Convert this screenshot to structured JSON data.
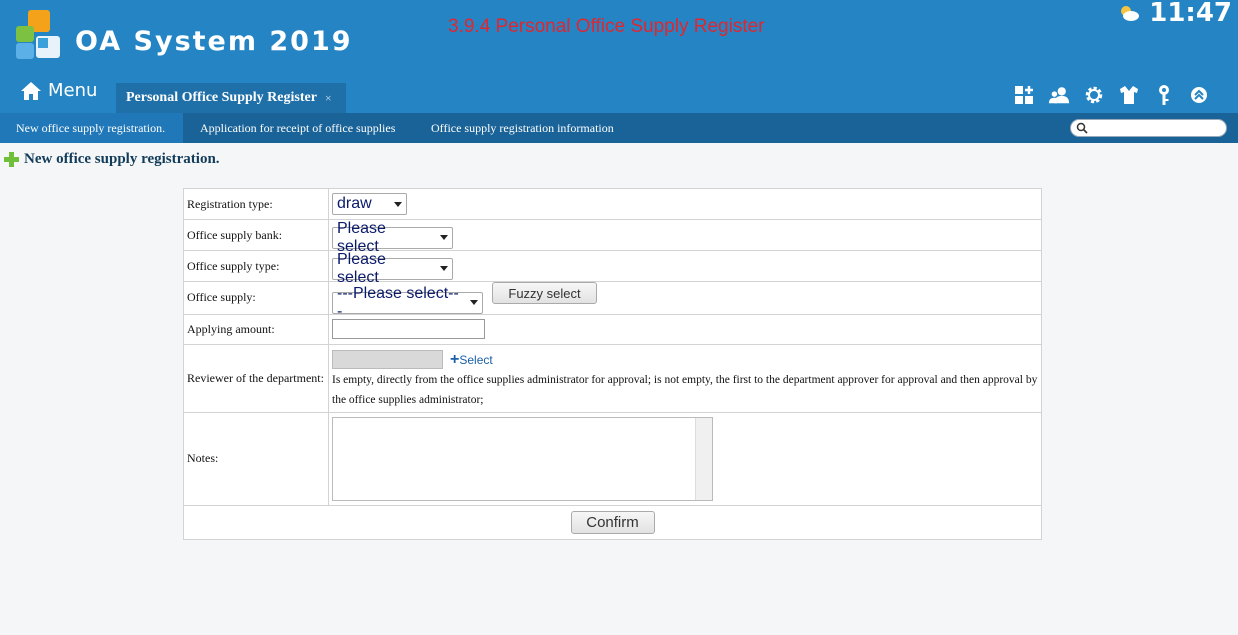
{
  "header": {
    "app_title": "OA System 2019",
    "page_heading": "3.9.4 Personal Office Supply Register",
    "clock": "11:47",
    "menu_label": "Menu",
    "tab_label": "Personal Office Supply Register",
    "tab_close": "×"
  },
  "subnav": {
    "items": [
      "New office supply registration.",
      "Application for receipt of office supplies",
      "Office supply registration information"
    ],
    "active_index": 0,
    "search_placeholder": ""
  },
  "section": {
    "title": "New office supply registration."
  },
  "form": {
    "registration_type": {
      "label": "Registration type:",
      "value": "draw"
    },
    "office_supply_bank": {
      "label": "Office supply bank:",
      "value": "Please select"
    },
    "office_supply_type": {
      "label": "Office supply type:",
      "value": "Please select"
    },
    "office_supply": {
      "label": "Office supply:",
      "value": "---Please select---",
      "fuzzy_label": "Fuzzy select"
    },
    "applying_amount": {
      "label": "Applying amount:",
      "value": ""
    },
    "reviewer": {
      "label": "Reviewer of the department:",
      "select_label": "Select",
      "hint": "Is empty, directly from the office supplies administrator for approval; is not empty, the first to the department approver for approval and then approval by the office supplies administrator;"
    },
    "notes": {
      "label": "Notes:",
      "value": ""
    },
    "confirm_label": "Confirm"
  },
  "colors": {
    "header_bg": "#2585c4",
    "subnav_bg": "#1a6399",
    "heading_red": "#e0262f"
  },
  "icons": [
    "app-logo-icon",
    "weather-icon",
    "home-icon",
    "grid-add-icon",
    "users-icon",
    "gear-icon",
    "shirt-icon",
    "key-icon",
    "collapse-up-icon",
    "search-icon",
    "plus-icon"
  ]
}
